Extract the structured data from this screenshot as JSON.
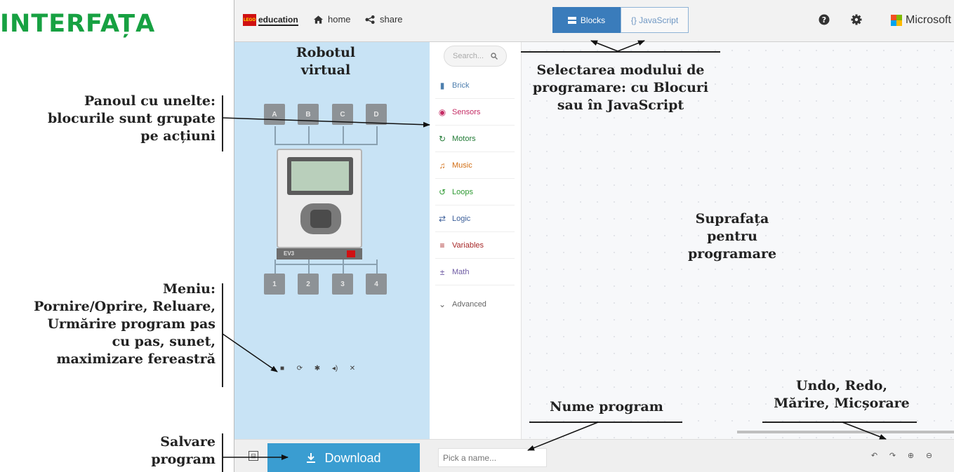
{
  "page_title": "INTERFAȚA",
  "annotations": {
    "toolbox_note": [
      "Panoul cu unelte:",
      "blocurile sunt grupate",
      "pe acțiuni"
    ],
    "menu_note": [
      "Meniu:",
      "Pornire/Oprire, Reluare,",
      "Urmărire program pas",
      "cu pas, sunet,",
      "maximizare fereastră"
    ],
    "save_note": [
      "Salvare",
      "program"
    ],
    "robot_note": [
      "Robotul",
      "virtual"
    ],
    "mode_note": [
      "Selectarea modului de",
      "programare: cu Blocuri",
      "sau în JavaScript"
    ],
    "workspace_note": [
      "Suprafața",
      "pentru",
      "programare"
    ],
    "name_note": "Nume program",
    "workspace_controls_note": [
      "Undo, Redo,",
      "Mărire, Micșorare"
    ]
  },
  "topbar": {
    "logo_mark": "LEGO",
    "logo_text": "education",
    "home": "home",
    "share": "share",
    "mode_blocks": "Blocks",
    "mode_js": "{} JavaScript",
    "brand": "Microsoft",
    "icons": [
      "help-icon",
      "settings-icon"
    ]
  },
  "simulator": {
    "input_ports": [
      "A",
      "B",
      "C",
      "D"
    ],
    "output_ports": [
      "1",
      "2",
      "3",
      "4"
    ],
    "brick_label": "EV3",
    "controls": [
      "stop-icon",
      "restart-icon",
      "debug-icon",
      "sound-icon",
      "fullscreen-icon"
    ],
    "background": "#c8e3f5"
  },
  "toolbox": {
    "search_placeholder": "Search...",
    "categories": [
      {
        "label": "Brick",
        "color": "#4e7fae",
        "icon": "brick-icon"
      },
      {
        "label": "Sensors",
        "color": "#c42a63",
        "icon": "sensor-icon"
      },
      {
        "label": "Motors",
        "color": "#217a35",
        "icon": "motor-icon"
      },
      {
        "label": "Music",
        "color": "#d26d12",
        "icon": "music-icon"
      },
      {
        "label": "Loops",
        "color": "#2f9a33",
        "icon": "loops-icon"
      },
      {
        "label": "Logic",
        "color": "#3b5e99",
        "icon": "logic-icon"
      },
      {
        "label": "Variables",
        "color": "#a72929",
        "icon": "variables-icon"
      },
      {
        "label": "Math",
        "color": "#6e5aa3",
        "icon": "math-icon"
      },
      {
        "label": "Advanced",
        "color": "#666666",
        "icon": "advanced-icon"
      }
    ]
  },
  "bottombar": {
    "download": "Download",
    "name_placeholder": "Pick a name...",
    "workspace_controls": [
      "undo-icon",
      "redo-icon",
      "zoom-in-icon",
      "zoom-out-icon"
    ]
  },
  "colors": {
    "title_green": "#17a142",
    "accent_blue": "#3a7cbb",
    "download_blue": "#3a9dd1"
  }
}
